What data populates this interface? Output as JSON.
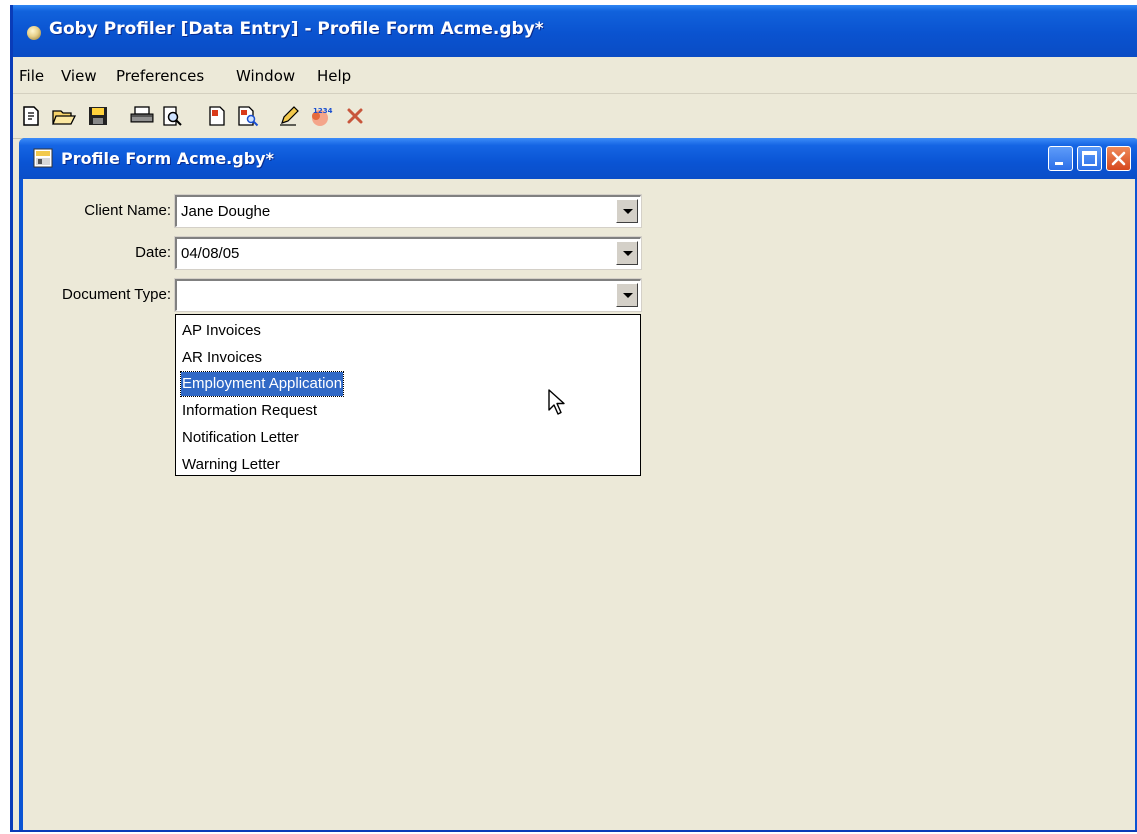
{
  "app": {
    "title": "Goby Profiler [Data Entry] - Profile Form Acme.gby*"
  },
  "menu": [
    "File",
    "View",
    "Preferences",
    "Window",
    "Help"
  ],
  "toolbar": {
    "icons": [
      "new-document-icon",
      "open-folder-icon",
      "save-disk-icon",
      "print-icon",
      "print-preview-icon",
      "red-document-icon",
      "document-search-icon",
      "pencil-icon",
      "numbering-icon",
      "delete-x-icon"
    ]
  },
  "child_window": {
    "title": "Profile Form Acme.gby*"
  },
  "form": {
    "client_name": {
      "label": "Client Name:",
      "value": "Jane Doughe"
    },
    "date": {
      "label": "Date:",
      "value": "04/08/05"
    },
    "document_type": {
      "label": "Document Type:",
      "value": "",
      "options": [
        "AP Invoices",
        "AR Invoices",
        "Employment Application",
        "Information Request",
        "Notification Letter",
        "Warning Letter"
      ],
      "highlighted": "Employment Application"
    }
  },
  "colors": {
    "titlebar": "#0A53D0",
    "window_bg": "#ECE9D8",
    "selection": "#3169C6",
    "close_button": "#D6481E"
  }
}
